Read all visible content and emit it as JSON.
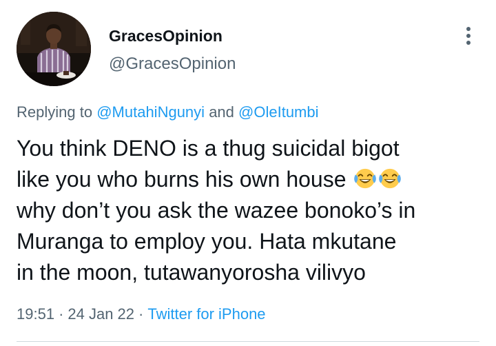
{
  "author": {
    "display_name": "GracesOpinion",
    "handle": "@GracesOpinion"
  },
  "icons": {
    "more": "more-vertical-icon",
    "emoji": "face-with-tears-of-joy-emoji"
  },
  "replying": {
    "prefix": "Replying to",
    "mention1": "@MutahiNgunyi",
    "conjunction": "and",
    "mention2": "@OleItumbi"
  },
  "tweet": {
    "lines": [
      "You think DENO is a thug suicidal bigot",
      "like you who burns his own house",
      "why don’t you ask the wazee bonoko’s in",
      "Muranga to employ you. Hata mkutane",
      "in the moon, tutawanyorosha vilivyo"
    ],
    "emoji_count": 2
  },
  "meta": {
    "time": "19:51",
    "date": "24 Jan 22",
    "source": "Twitter for iPhone",
    "separator": "·"
  },
  "colors": {
    "text": "#0f1419",
    "secondary": "#536471",
    "link": "#1d9bf0",
    "divider": "#cfd9de"
  }
}
